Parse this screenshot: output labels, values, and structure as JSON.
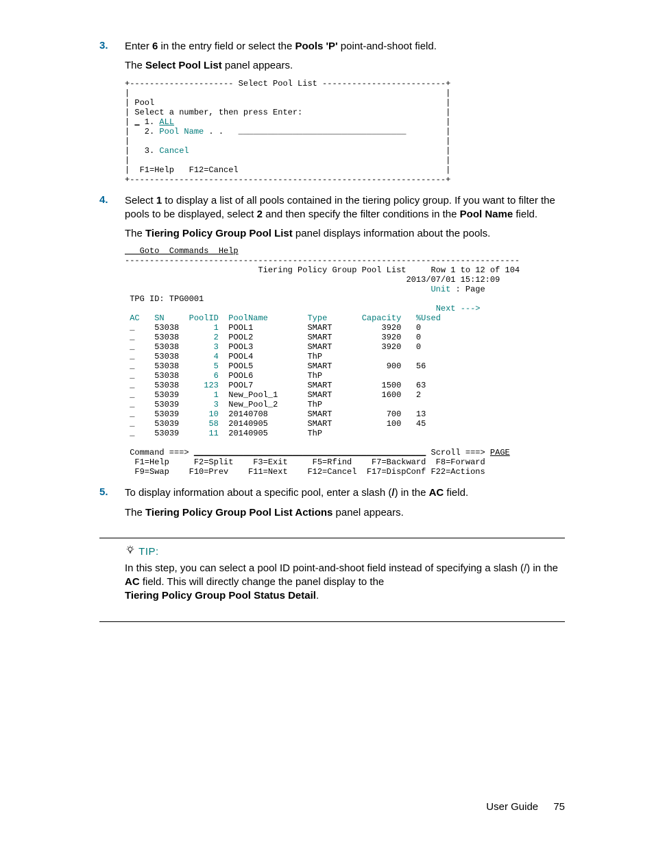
{
  "steps": {
    "s3": {
      "num": "3.",
      "text_pre": "Enter ",
      "bold1": "6",
      "text_mid1": " in the entry field or select the ",
      "bold2": "Pools 'P'",
      "text_post": " point-and-shoot field.",
      "para2_pre": "The ",
      "para2_bold": "Select Pool List",
      "para2_post": " panel appears."
    },
    "s4": {
      "num": "4.",
      "text_pre": "Select ",
      "bold1": "1",
      "text_mid1": " to display a list of all pools contained in the tiering policy group. If you want to filter the pools to be displayed, select ",
      "bold2": "2",
      "text_mid2": " and then specify the filter conditions in the ",
      "bold3": "Pool Name",
      "text_post": " field.",
      "para2_pre": "The ",
      "para2_bold": "Tiering Policy Group Pool List",
      "para2_post": " panel displays information about the pools."
    },
    "s5": {
      "num": "5.",
      "text_pre": "To display information about a specific pool, enter a slash (",
      "bold1": "/",
      "text_mid1": ") in the ",
      "bold2": "AC",
      "text_post": " field.",
      "para2_pre": "The ",
      "para2_bold": "Tiering Policy Group Pool List Actions",
      "para2_post": " panel appears."
    }
  },
  "panel1": {
    "border_top": "+--------------------- Select Pool List -------------------------+",
    "blank": "|                                                                |",
    "pool": "| Pool                                                           |",
    "select": "| Select a number, then press Enter:                             |",
    "opt1_pre": "| ",
    "opt1_us": "_",
    "opt1_num": " 1. ",
    "opt1_lbl": "ALL",
    "opt1_post": "                                                       |",
    "opt2_pre": "|   2. ",
    "opt2_lbl": "Pool Name",
    "opt2_dots": " . .   __________________________________",
    "opt2_post": "        |",
    "opt3_pre": "|   3. ",
    "opt3_lbl": "Cancel",
    "opt3_post": "                                                    |",
    "fkeys": "|  F1=Help   F12=Cancel                                          |",
    "border_bot": "+----------------------------------------------------------------+"
  },
  "panel2": {
    "menu": "   Goto  Commands  Help",
    "dash": "--------------------------------------------------------------------------------",
    "title_line": "                           Tiering Policy Group Pool List     Row 1 to 12 of 104",
    "date_line": "                                                         2013/07/01 15:12:09",
    "unit_pre": "                                                              ",
    "unit_lbl": "Unit",
    "unit_post": " : Page",
    "tpg": " TPG ID: TPG0001",
    "next_pre": "                                                               ",
    "next_lbl": "Next --->",
    "hdr": {
      "ac": "AC",
      "sn": "SN",
      "poolid": "PoolID",
      "poolname": "PoolName",
      "type": "Type",
      "capacity": "Capacity",
      "used": "%Used"
    },
    "rows": [
      {
        "ac": "_",
        "sn": "53038",
        "poolid": "1",
        "poolname": "POOL1",
        "type": "SMART",
        "capacity": "3920",
        "used": "0"
      },
      {
        "ac": "_",
        "sn": "53038",
        "poolid": "2",
        "poolname": "POOL2",
        "type": "SMART",
        "capacity": "3920",
        "used": "0"
      },
      {
        "ac": "_",
        "sn": "53038",
        "poolid": "3",
        "poolname": "POOL3",
        "type": "SMART",
        "capacity": "3920",
        "used": "0"
      },
      {
        "ac": "_",
        "sn": "53038",
        "poolid": "4",
        "poolname": "POOL4",
        "type": "ThP",
        "capacity": "",
        "used": ""
      },
      {
        "ac": "_",
        "sn": "53038",
        "poolid": "5",
        "poolname": "POOL5",
        "type": "SMART",
        "capacity": "900",
        "used": "56"
      },
      {
        "ac": "_",
        "sn": "53038",
        "poolid": "6",
        "poolname": "POOL6",
        "type": "ThP",
        "capacity": "",
        "used": ""
      },
      {
        "ac": "_",
        "sn": "53038",
        "poolid": "123",
        "poolname": "POOL7",
        "type": "SMART",
        "capacity": "1500",
        "used": "63"
      },
      {
        "ac": "_",
        "sn": "53039",
        "poolid": "1",
        "poolname": "New_Pool_1",
        "type": "SMART",
        "capacity": "1600",
        "used": "2"
      },
      {
        "ac": "_",
        "sn": "53039",
        "poolid": "3",
        "poolname": "New_Pool_2",
        "type": "ThP",
        "capacity": "",
        "used": ""
      },
      {
        "ac": "_",
        "sn": "53039",
        "poolid": "10",
        "poolname": "20140708",
        "type": "SMART",
        "capacity": "700",
        "used": "13"
      },
      {
        "ac": "_",
        "sn": "53039",
        "poolid": "58",
        "poolname": "20140905",
        "type": "SMART",
        "capacity": "100",
        "used": "45"
      },
      {
        "ac": "_",
        "sn": "53039",
        "poolid": "11",
        "poolname": "20140905",
        "type": "ThP",
        "capacity": "",
        "used": ""
      }
    ],
    "cmd_pre": " Command ===> ",
    "cmd_us": "_______________________________________________",
    "scroll_pre": " Scroll ===> ",
    "scroll_lbl": "PAGE",
    "fk1": "  F1=Help     F2=Split    F3=Exit     F5=Rfind    F7=Backward  F8=Forward",
    "fk2": "  F9=Swap    F10=Prev    F11=Next    F12=Cancel  F17=DispConf F22=Actions"
  },
  "tip": {
    "label": "TIP:",
    "body_pre": "In this step, you can select a pool ID point-and-shoot field instead of specifying a slash (/) in the ",
    "bold1": "AC",
    "body_mid": " field. This will directly change the panel display to the ",
    "bold2": "Tiering Policy Group Pool Status Detail",
    "body_post": "."
  },
  "footer": {
    "label": "User Guide",
    "page": "75"
  }
}
